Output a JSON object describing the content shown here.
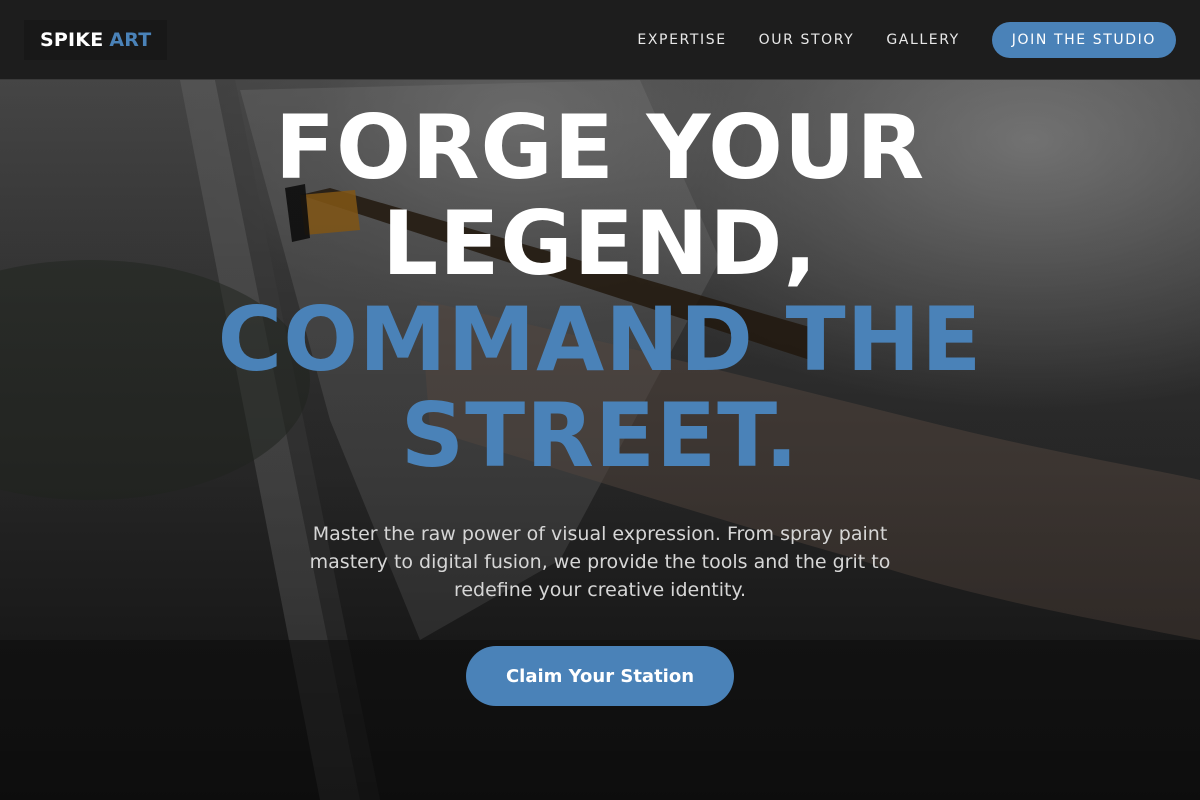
{
  "brand": {
    "name_part1": "SPIKE",
    "name_part2": "ART"
  },
  "nav": {
    "links": [
      "EXPERTISE",
      "OUR STORY",
      "GALLERY"
    ],
    "cta_label": "JOIN THE STUDIO"
  },
  "hero": {
    "headline_white_1": "FORGE YOUR",
    "headline_white_2": "LEGEND,",
    "headline_blue_1": "COMMAND THE",
    "headline_blue_2": "STREET.",
    "subtext": "Master the raw power of visual expression. From spray paint mastery to digital fusion, we provide the tools and the grit to redefine your creative identity.",
    "cta_label": "Claim Your Station"
  },
  "colors": {
    "accent": "#4a82b8",
    "nav_bg": "#1d1d1d",
    "text_white": "#ffffff"
  }
}
